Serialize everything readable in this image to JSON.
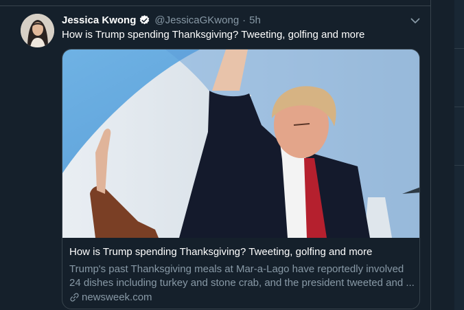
{
  "tweet": {
    "author_name": "Jessica Kwong",
    "handle": "@JessicaGKwong",
    "separator": "·",
    "time": "5h",
    "text": "How is Trump spending Thanksgiving? Tweeting, golfing and more"
  },
  "card": {
    "title": "How is Trump spending Thanksgiving? Tweeting, golfing and more",
    "description": "Trump's past Thanksgiving meals at Mar-a-Lago have reportedly involved 24 dishes including turkey and stone crab, and the president tweeted and ...",
    "domain": "newsweek.com",
    "icon": "link-icon"
  },
  "icons": {
    "verified": "verified-badge-icon",
    "more": "chevron-down-icon"
  },
  "colors": {
    "background": "#15202b",
    "border": "#38444d",
    "primary_text": "#ffffff",
    "secondary_text": "#8899a6",
    "verified": "#ffffff"
  }
}
